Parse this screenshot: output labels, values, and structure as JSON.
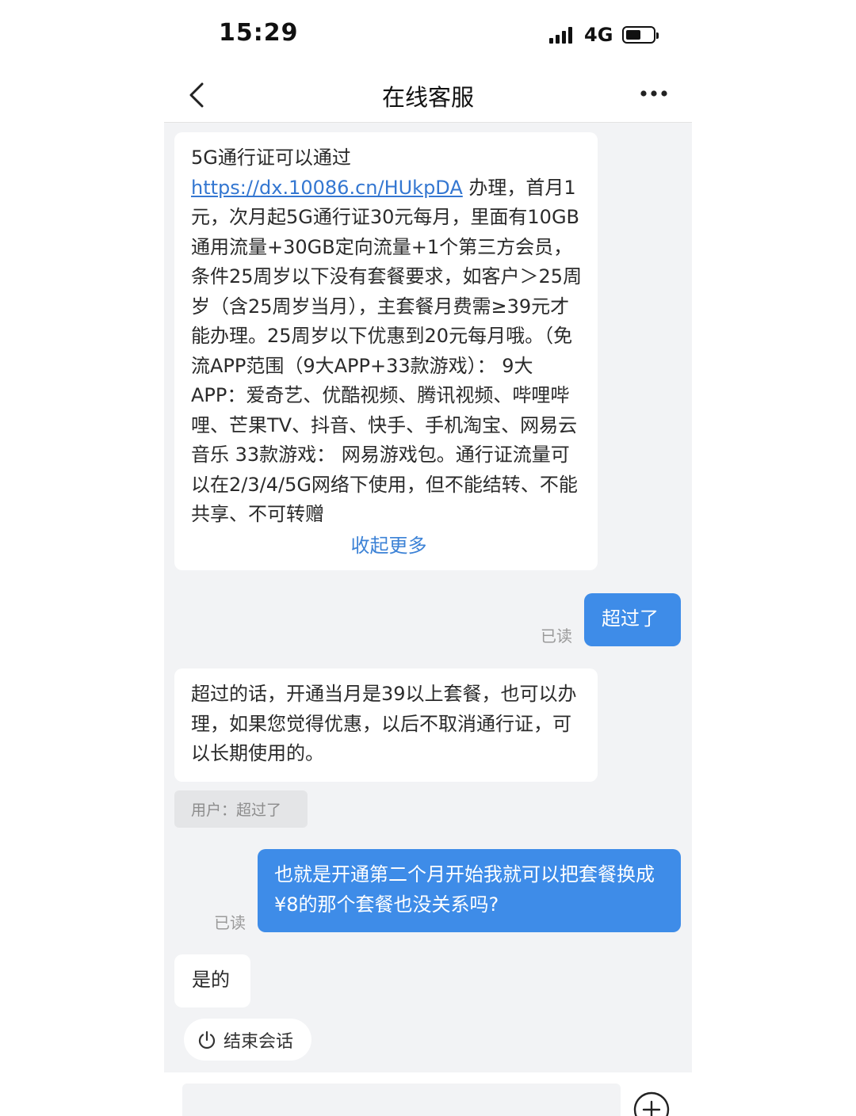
{
  "status_bar": {
    "time": "15:29",
    "network": "4G",
    "icons": [
      "signal-icon",
      "battery-icon"
    ]
  },
  "nav": {
    "title": "在线客服",
    "icons": [
      "back-chevron-icon",
      "more-dots-icon"
    ]
  },
  "messages": [
    {
      "sender": "agent",
      "text_before_link": "5G通行证可以通过 ",
      "link": "https://dx.10086.cn/HUkpDA",
      "text_after_link": " 办理，首月1元，次月起5G通行证30元每月，里面有10GB通用流量+30GB定向流量+1个第三方会员，条件25周岁以下没有套餐要求，如客户＞25周岁（含25周岁当月），主套餐月费需≥39元才能办理。25周岁以下优惠到20元每月哦。（免流APP范围（9大APP+33款游戏）： 9大APP：爱奇艺、优酷视频、腾讯视频、哔哩哔哩、芒果TV、抖音、快手、手机淘宝、网易云音乐 33款游戏： 网易游戏包。通行证流量可以在2/3/4/5G网络下使用，但不能结转、不能共享、不可转赠",
      "collapse_label": "收起更多"
    },
    {
      "sender": "user",
      "text": "超过了",
      "read_status": "已读"
    },
    {
      "sender": "agent",
      "text": "超过的话，开通当月是39以上套餐，也可以办理，如果您觉得优惠，以后不取消通行证，可以长期使用的。",
      "quote": "用户：超过了"
    },
    {
      "sender": "user",
      "text": "也就是开通第二个月开始我就可以把套餐换成¥8的那个套餐也没关系吗?",
      "read_status": "已读"
    },
    {
      "sender": "agent",
      "text": "是的"
    }
  ],
  "end_session": {
    "label": "结束会话",
    "icon": "power-icon"
  },
  "input_bar": {
    "placeholder": "",
    "icons": [
      "plus-circle-icon"
    ]
  },
  "colors": {
    "user_bubble": "#3e8ce8",
    "link": "#3477d1",
    "chat_background": "#f2f3f5"
  }
}
